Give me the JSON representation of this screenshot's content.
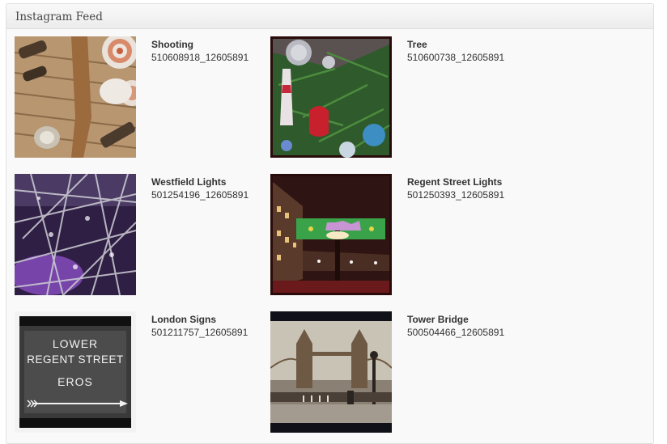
{
  "widget": {
    "title": "Instagram Feed"
  },
  "items": [
    {
      "title": "Shooting",
      "id": "510608918_12605891",
      "image": "shooting-photo"
    },
    {
      "title": "Tree",
      "id": "510600738_12605891",
      "image": "tree-photo"
    },
    {
      "title": "Westfield Lights",
      "id": "501254196_12605891",
      "image": "westfield-lights-photo"
    },
    {
      "title": "Regent Street Lights",
      "id": "501250393_12605891",
      "image": "regent-street-lights-photo"
    },
    {
      "title": "London Signs",
      "id": "501211757_12605891",
      "image": "london-signs-photo",
      "sign_text": [
        "LOWER",
        "REGENT STREET",
        "EROS"
      ]
    },
    {
      "title": "Tower Bridge",
      "id": "500504466_12605891",
      "image": "tower-bridge-photo"
    }
  ]
}
